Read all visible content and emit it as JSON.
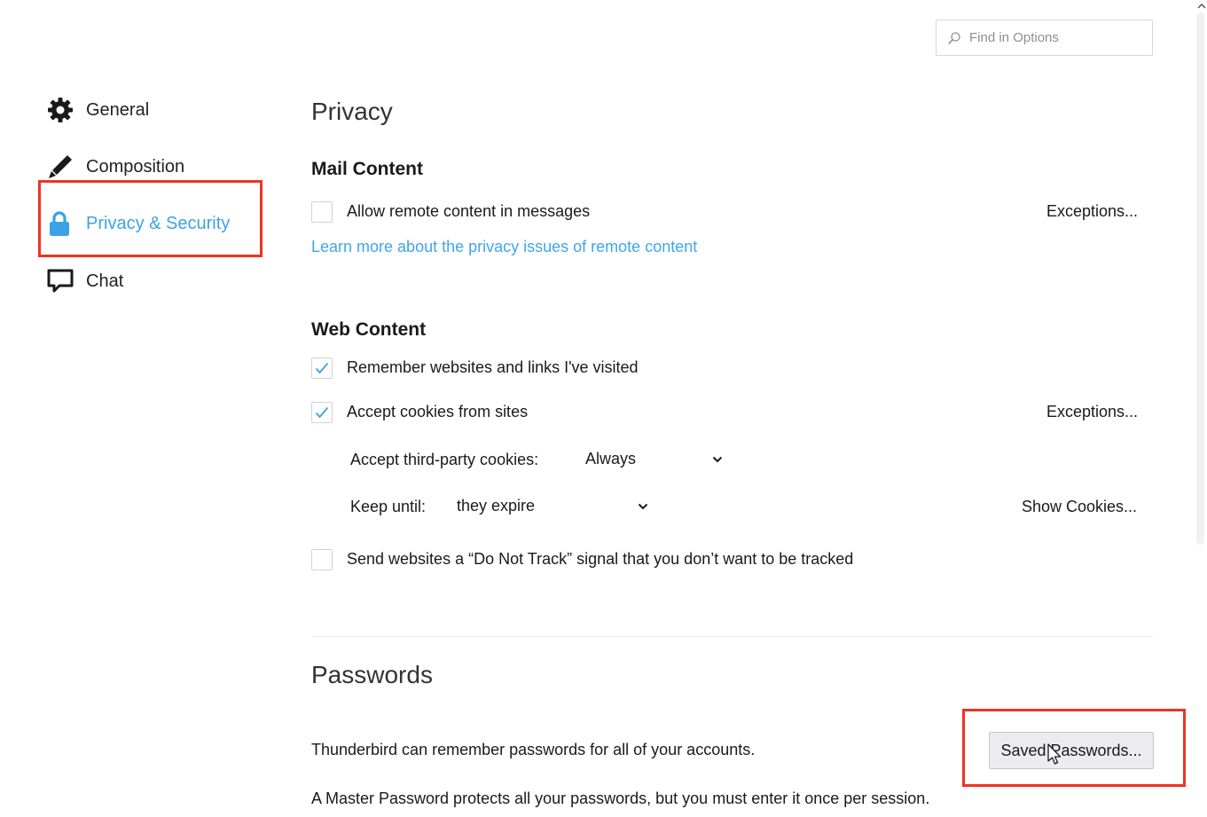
{
  "search": {
    "placeholder": "Find in Options"
  },
  "sidebar": {
    "items": [
      {
        "label": "General",
        "icon": "gear-icon"
      },
      {
        "label": "Composition",
        "icon": "pencil-icon"
      },
      {
        "label": "Privacy & Security",
        "icon": "lock-icon",
        "selected": true
      },
      {
        "label": "Chat",
        "icon": "chat-bubble-icon"
      }
    ]
  },
  "privacy": {
    "title": "Privacy",
    "mail_content": {
      "heading": "Mail Content",
      "allow_remote": {
        "label": "Allow remote content in messages",
        "checked": false
      },
      "exceptions_label": "Exceptions...",
      "learn_more": "Learn more about the privacy issues of remote content"
    },
    "web_content": {
      "heading": "Web Content",
      "remember": {
        "label": "Remember websites and links I've visited",
        "checked": true
      },
      "cookies": {
        "label": "Accept cookies from sites",
        "checked": true
      },
      "exceptions_label": "Exceptions...",
      "third_party_label": "Accept third-party cookies:",
      "third_party_value": "Always",
      "keep_until_label": "Keep until:",
      "keep_until_value": "they expire",
      "show_cookies_label": "Show Cookies...",
      "dnt": {
        "label": "Send websites a “Do Not Track” signal that you don’t want to be tracked",
        "checked": false
      }
    }
  },
  "passwords": {
    "title": "Passwords",
    "remember_text": "Thunderbird can remember passwords for all of your accounts.",
    "saved_button": "Saved Passwords...",
    "master_text": "A Master Password protects all your passwords, but you must enter it once per session."
  },
  "colors": {
    "accent": "#3aa3e6",
    "highlight": "#ee3322"
  }
}
